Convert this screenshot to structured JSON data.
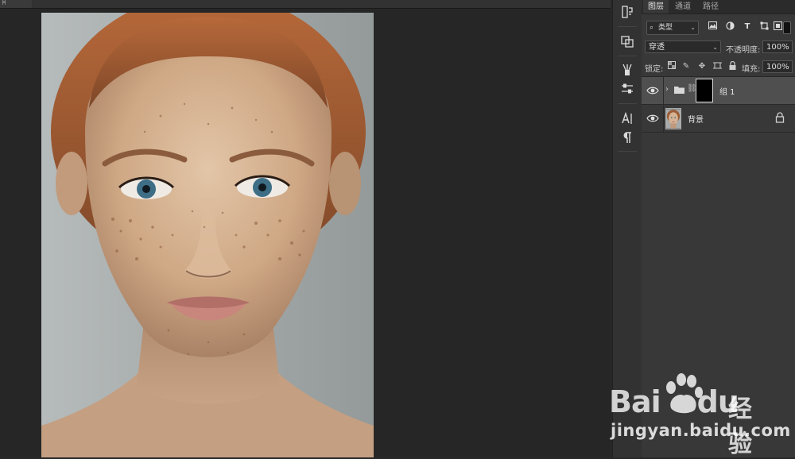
{
  "document": {
    "tab_label": "ꃫ"
  },
  "layers_panel": {
    "tabs": [
      {
        "label": "图层",
        "active": true
      },
      {
        "label": "通道",
        "active": false
      },
      {
        "label": "路径",
        "active": false
      }
    ],
    "filter": {
      "type_label": "类型",
      "icons": [
        "image-filter-icon",
        "adjustment-filter-icon",
        "type-filter-icon",
        "shape-filter-icon",
        "smart-object-filter-icon"
      ]
    },
    "blend_mode": "穿透",
    "opacity_label": "不透明度:",
    "opacity_value": "100%",
    "lock_label": "锁定:",
    "fill_label": "填充:",
    "fill_value": "100%",
    "layers": [
      {
        "name": "组 1",
        "type": "group",
        "selected": true,
        "visible": true,
        "has_mask": true
      },
      {
        "name": "背景",
        "type": "background",
        "selected": false,
        "visible": true,
        "locked": true
      }
    ]
  },
  "watermark": {
    "brand": "Bai",
    "brand_suffix": "du",
    "product": "经验",
    "url": "jingyan.baidu.com"
  },
  "colors": {
    "panel_bg": "#383838",
    "selected_row": "#4f4f4f",
    "canvas_bg": "#262626"
  }
}
